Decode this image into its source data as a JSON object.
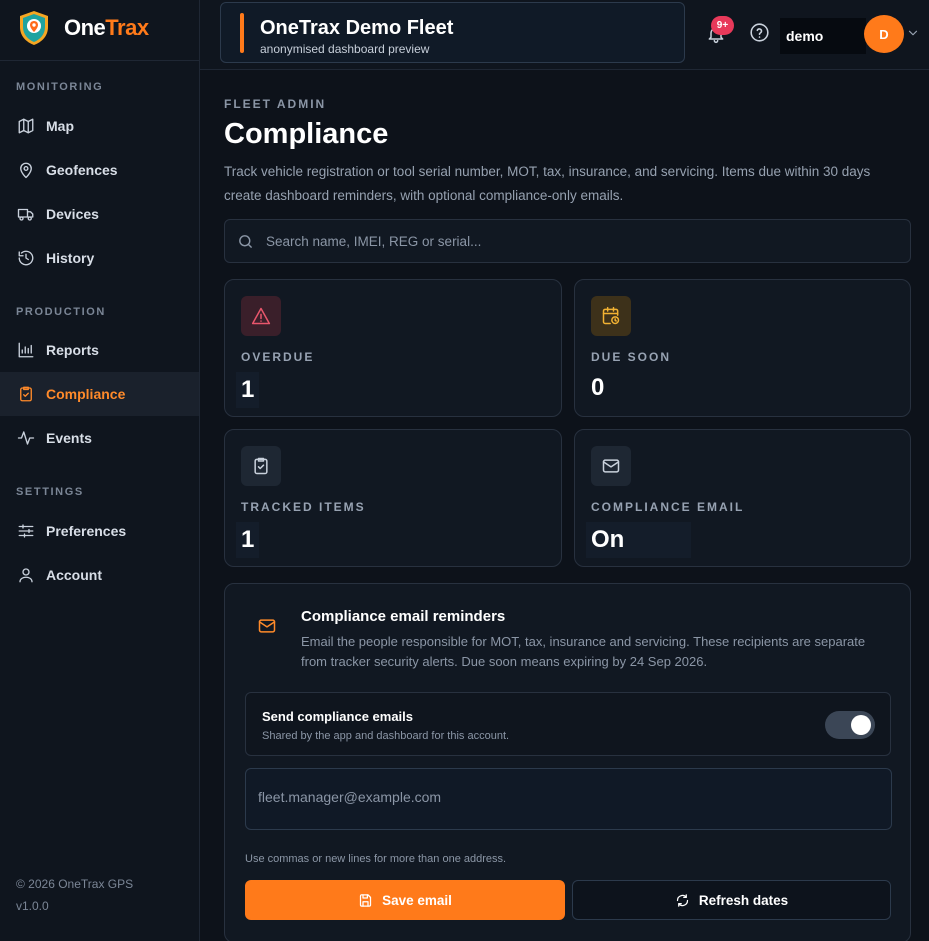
{
  "brand": {
    "name_part1": "One",
    "name_part2": "Trax",
    "accent": "#ff7a1a"
  },
  "sidebar": {
    "sections": [
      {
        "label": "MONITORING",
        "items": [
          {
            "label": "Map",
            "icon": "map-icon"
          },
          {
            "label": "Geofences",
            "icon": "map-pin-icon"
          },
          {
            "label": "Devices",
            "icon": "truck-icon"
          },
          {
            "label": "History",
            "icon": "history-icon"
          }
        ]
      },
      {
        "label": "PRODUCTION",
        "items": [
          {
            "label": "Reports",
            "icon": "bar-chart-icon"
          },
          {
            "label": "Compliance",
            "icon": "clipboard-check-icon",
            "active": true
          },
          {
            "label": "Events",
            "icon": "activity-icon"
          }
        ]
      },
      {
        "label": "SETTINGS",
        "items": [
          {
            "label": "Preferences",
            "icon": "sliders-icon"
          },
          {
            "label": "Account",
            "icon": "user-icon"
          }
        ]
      }
    ],
    "footer": {
      "copyright": "© 2026 OneTrax GPS",
      "version": "v1.0.0"
    }
  },
  "topbar": {
    "fleet_title": "OneTrax Demo Fleet",
    "fleet_subtitle": "anonymised dashboard preview",
    "notification_badge": "9+",
    "user_name": "demo",
    "avatar_initial": "D"
  },
  "page": {
    "eyebrow": "FLEET ADMIN",
    "title": "Compliance",
    "description": "Track vehicle registration or tool serial number, MOT, tax, insurance, and servicing. Items due within 30 days create dashboard reminders, with optional compliance-only emails."
  },
  "search": {
    "placeholder": "Search name, IMEI, REG or serial..."
  },
  "stats": [
    {
      "label": "OVERDUE",
      "value": "1",
      "icon": "alert-triangle-icon",
      "color": "#e8566c"
    },
    {
      "label": "DUE SOON",
      "value": "0",
      "icon": "calendar-clock-icon",
      "color": "#f2b233"
    },
    {
      "label": "TRACKED ITEMS",
      "value": "1",
      "icon": "clipboard-check-icon",
      "color": "#c9d1dc"
    },
    {
      "label": "COMPLIANCE EMAIL",
      "value": "On",
      "icon": "mail-icon",
      "color": "#c9d1dc"
    }
  ],
  "email_panel": {
    "title": "Compliance email reminders",
    "description": "Email the people responsible for MOT, tax, insurance and servicing. These recipients are separate from tracker security alerts. Due soon means expiring by 24 Sep 2026.",
    "toggle_title": "Send compliance emails",
    "toggle_subtitle": "Shared by the app and dashboard for this account.",
    "toggle_on": true,
    "email_placeholder": "fleet.manager@example.com",
    "hint": "Use commas or new lines for more than one address.",
    "save_label": "Save email",
    "refresh_label": "Refresh dates"
  }
}
